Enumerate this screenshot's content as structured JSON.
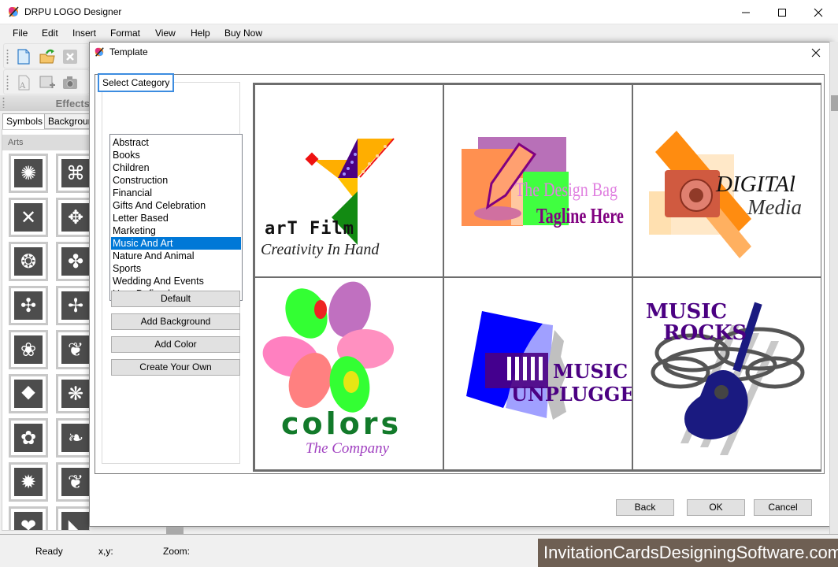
{
  "app": {
    "title": "DRPU LOGO Designer",
    "window_controls": [
      "minimize",
      "maximize",
      "close"
    ]
  },
  "menu": [
    "File",
    "Edit",
    "Insert",
    "Format",
    "View",
    "Help",
    "Buy Now"
  ],
  "toolbar1": [
    {
      "name": "new-file-icon",
      "enabled": true
    },
    {
      "name": "open-folder-icon",
      "enabled": true
    },
    {
      "name": "close-file-icon",
      "enabled": false
    }
  ],
  "toolbar2": [
    {
      "name": "add-text-icon",
      "enabled": false
    },
    {
      "name": "add-image-icon",
      "enabled": false
    },
    {
      "name": "camera-icon",
      "enabled": false
    }
  ],
  "effects_panel": {
    "title": "Effects",
    "tabs": [
      "Symbols",
      "Backgrour"
    ],
    "active_tab": "Symbols",
    "section_label": "Arts",
    "symbols": [
      "triskelion",
      "square-knot",
      "x-lattice",
      "diamond-cross",
      "oval-knot",
      "circle-knot",
      "cross-petal",
      "swirl-dots",
      "lotus",
      "scroll",
      "diamond-leaf",
      "fan-shell",
      "diamond-fan",
      "tree-ornament",
      "mandala",
      "wave-scroll",
      "heart-knot",
      "arc-ornament"
    ]
  },
  "dialog": {
    "title": "Template",
    "category_label": "Select Category",
    "categories": [
      "Abstract",
      "Books",
      "Children",
      "Construction",
      "Financial",
      "Gifts And Celebration",
      "Letter Based",
      "Marketing",
      "Music And Art",
      "Nature And Animal",
      "Sports",
      "Wedding And Events",
      "User Defined"
    ],
    "selected_category": "Music And Art",
    "side_buttons": [
      "Default",
      "Add Background",
      "Add Color",
      "Create Your Own"
    ],
    "templates": [
      {
        "id": "art-film",
        "line1": "arT Film",
        "line2": "Creativity In Hand"
      },
      {
        "id": "design-bag",
        "line1": "The Design Bag",
        "line2": "Tagline Here"
      },
      {
        "id": "digital-media",
        "line1": "DIGITAl",
        "line2": "Media"
      },
      {
        "id": "colors",
        "line1": "colors",
        "line2": "The Company"
      },
      {
        "id": "music-unplugged",
        "line1": "MUSIC",
        "line2": "UNPLUGGED"
      },
      {
        "id": "music-rocks",
        "line1": "MUSIC",
        "line2": "ROCKS"
      }
    ],
    "buttons": {
      "back": "Back",
      "ok": "OK",
      "cancel": "Cancel"
    }
  },
  "status": {
    "ready": "Ready",
    "xy_label": "x,y:",
    "zoom_label": "Zoom:"
  },
  "watermark": "InvitationCardsDesigningSoftware.com",
  "colors": {
    "selection": "#0078d7",
    "focus_border": "#3c8ce0",
    "watermark_bg": "#6e5f53"
  }
}
